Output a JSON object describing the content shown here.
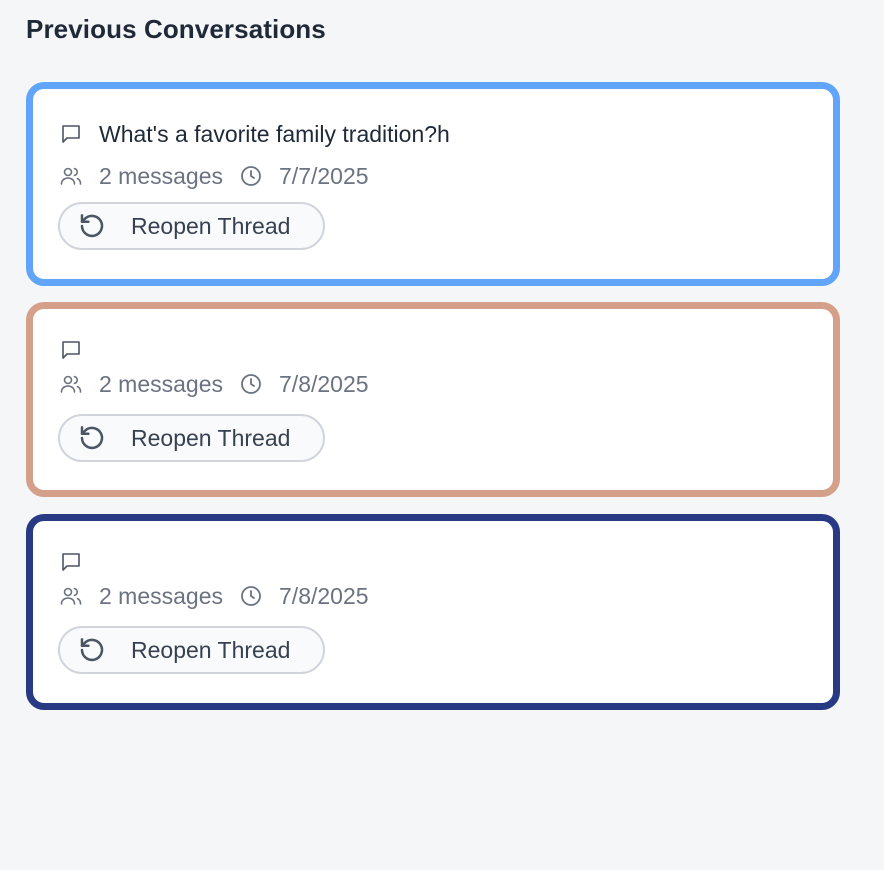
{
  "heading": "Previous Conversations",
  "threads": [
    {
      "title": "What's a favorite family tradition?h",
      "messages": "2 messages",
      "date": "7/7/2025",
      "reopen_label": "Reopen Thread",
      "border_color": "#60a5fa"
    },
    {
      "title": "",
      "messages": "2 messages",
      "date": "7/8/2025",
      "reopen_label": "Reopen Thread",
      "border_color": "#d4a08a"
    },
    {
      "title": "",
      "messages": "2 messages",
      "date": "7/8/2025",
      "reopen_label": "Reopen Thread",
      "border_color": "#283a84"
    }
  ],
  "icons": {
    "title": "message-square-icon",
    "messages": "users-icon",
    "date": "clock-icon",
    "reopen": "rotate-ccw-icon"
  }
}
